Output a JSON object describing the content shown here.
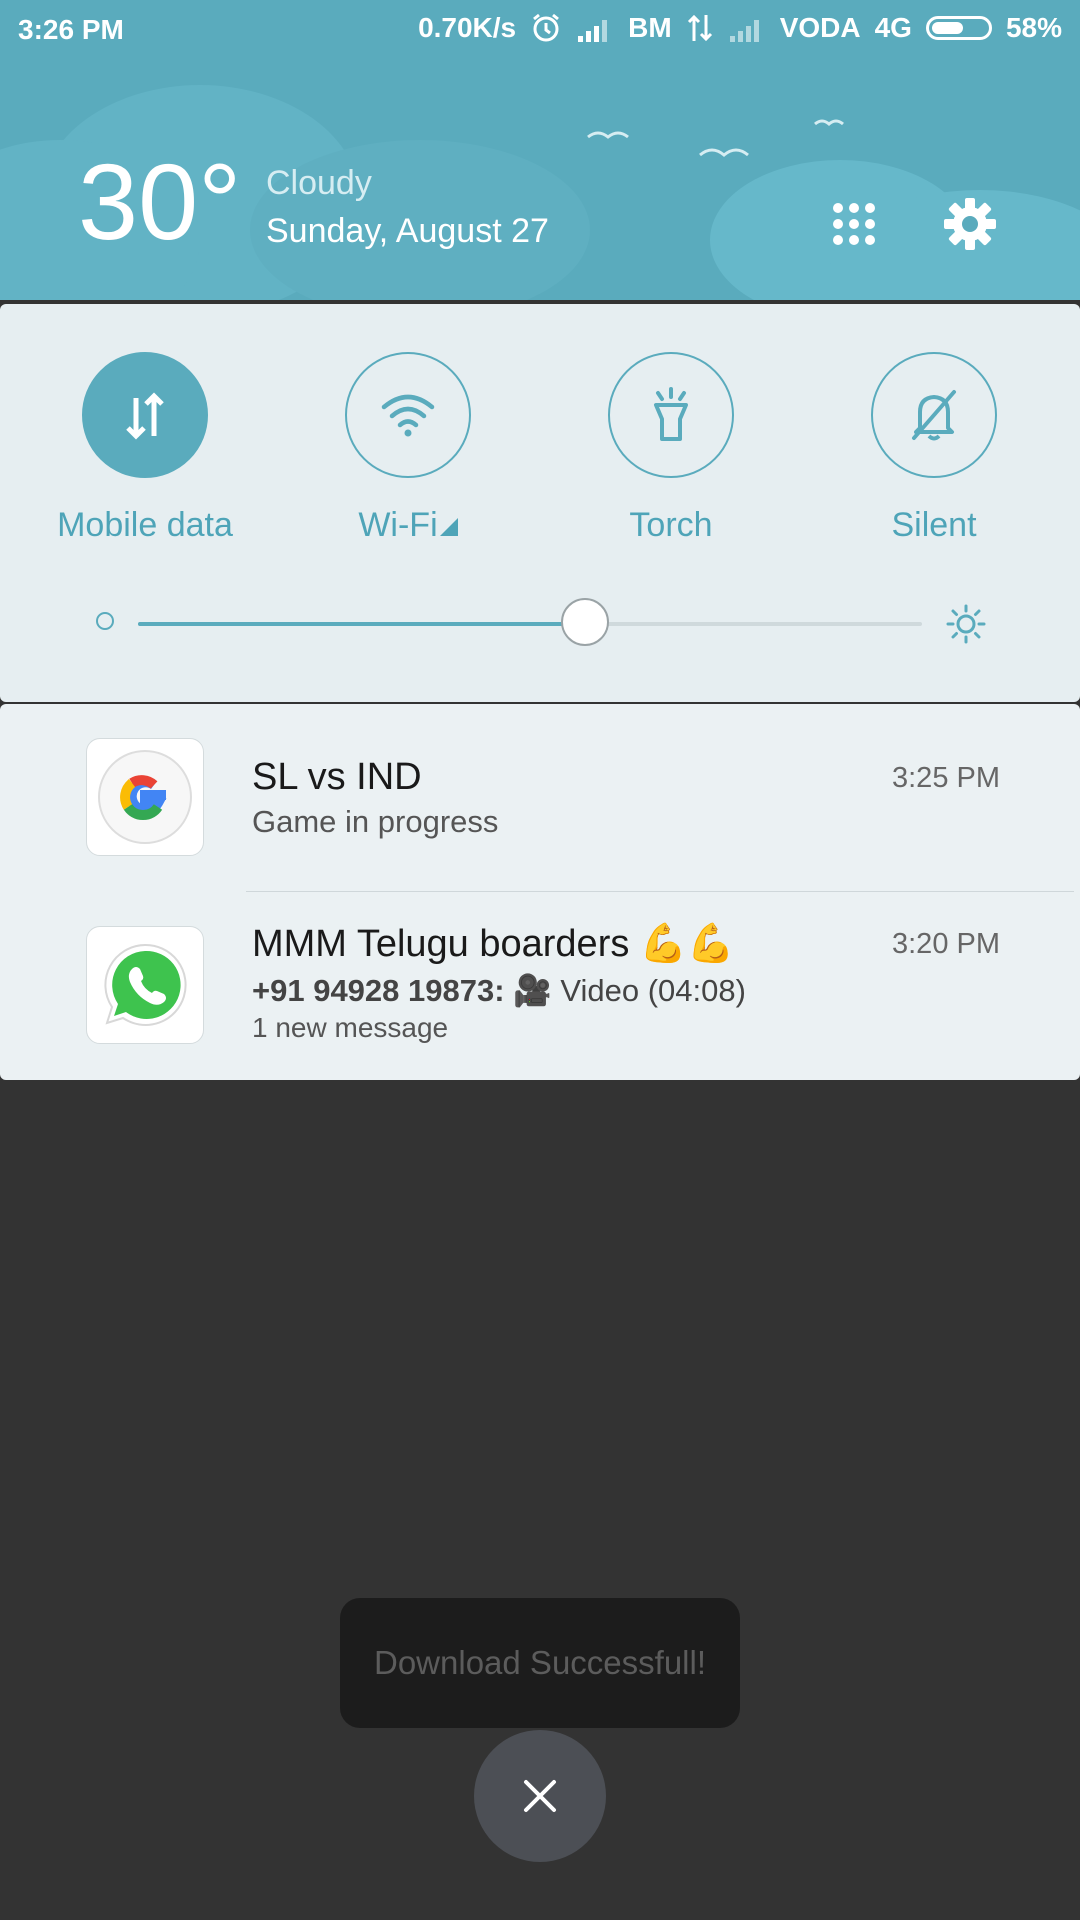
{
  "status_bar": {
    "time": "3:26 PM",
    "net_speed": "0.70K/s",
    "carrier1": "BM",
    "carrier2": "VODA",
    "network_type": "4G",
    "battery_percent_label": "58%",
    "battery_level": 0.58,
    "icons": [
      "alarm-icon",
      "signal-icon",
      "data-arrows-icon",
      "signal-icon",
      "battery-icon"
    ]
  },
  "weather": {
    "temperature": "30°",
    "condition": "Cloudy",
    "date": "Sunday, August 27"
  },
  "header_buttons": [
    "app-grid-icon",
    "gear-icon"
  ],
  "quick_settings": {
    "toggles": [
      {
        "label": "Mobile data",
        "icon": "mobile-data-icon",
        "active": true
      },
      {
        "label": "Wi-Fi",
        "icon": "wifi-icon",
        "active": false
      },
      {
        "label": "Torch",
        "icon": "torch-icon",
        "active": false
      },
      {
        "label": "Silent",
        "icon": "silent-bell-icon",
        "active": false
      }
    ],
    "brightness_level": 0.57
  },
  "notifications": [
    {
      "app_icon": "google-icon",
      "title": "SL vs IND",
      "text": "Game in progress",
      "time": "3:25 PM"
    },
    {
      "app_icon": "whatsapp-icon",
      "title": "MMM Telugu boarders 💪💪",
      "sender": "+91 94928 19873:",
      "text": "🎥 Video (04:08)",
      "subtext": "1 new message",
      "time": "3:20 PM"
    }
  ],
  "toast": {
    "message": "Download Successfull!"
  },
  "colors": {
    "accent": "#5aabbd",
    "panel_bg": "#e6eef1",
    "overlay_bg": "#333333"
  }
}
